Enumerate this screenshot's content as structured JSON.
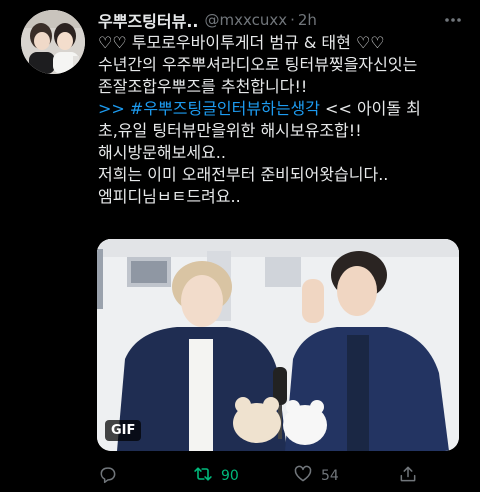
{
  "tweet": {
    "display_name": "우뿌즈팅터뷰..",
    "handle": "@mxxcuxx",
    "separator": "·",
    "time": "2h",
    "lines": [
      "♡♡ 투모로우바이투게더 범규 & 태현 ♡♡",
      "수년간의 우주뿌셔라디오로 팅터뷰찢을자신잇는",
      "존잘조합우뿌즈를 추천합니다!!"
    ],
    "hashtag_prefix": ">> ",
    "hashtag": "#우뿌즈팅글인터뷰하는생각",
    "hashtag_suffix": " << 아이돌 최",
    "lines2": [
      "초,유일 팅터뷰만을위한 해시보유조합!!",
      "해시방문해보세요..",
      "저희는 이미 오래전부터 준비되어왓습니다..",
      "엠피디님ㅂㅌ드려요.."
    ],
    "gif_badge": "GIF"
  },
  "actions": {
    "reply_count": "",
    "retweet_count": "90",
    "like_count": "54"
  },
  "colors": {
    "background": "#000000",
    "text": "#e7e9ea",
    "muted": "#71767b",
    "link": "#1d9bf0",
    "retweet_active": "#00ba7c"
  },
  "icons": [
    "more-icon",
    "reply-icon",
    "retweet-icon",
    "like-icon",
    "share-icon"
  ]
}
